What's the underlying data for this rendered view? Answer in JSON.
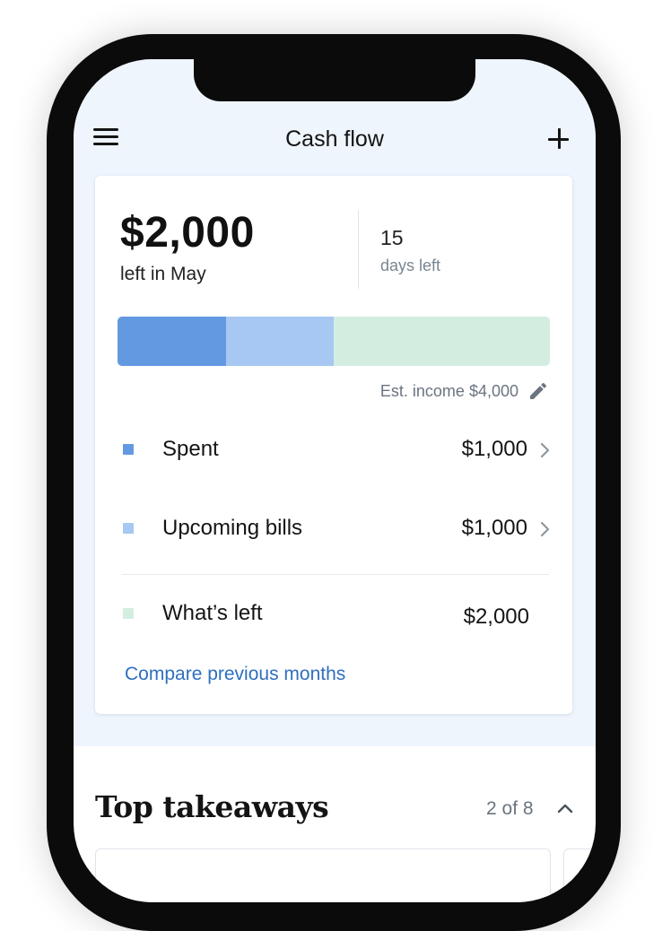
{
  "header": {
    "title": "Cash flow",
    "menu_icon": "hamburger-menu-icon",
    "add_icon": "plus-icon"
  },
  "summary": {
    "amount": "$2,000",
    "caption": "left in May",
    "days_count": "15",
    "days_label": "days left"
  },
  "progress_bar": {
    "total": 4000,
    "segments": [
      {
        "name": "Spent",
        "value": 1000,
        "color": "#6399e0"
      },
      {
        "name": "Upcoming bills",
        "value": 1000,
        "color": "#a6c8f2"
      },
      {
        "name": "What’s left",
        "value": 2000,
        "color": "#d3ede1"
      }
    ]
  },
  "income": {
    "label": "Est. income $4,000",
    "edit_icon": "pencil-icon"
  },
  "legend": [
    {
      "label": "Spent",
      "value": "$1,000",
      "color": "#6399e0",
      "chevron": true
    },
    {
      "label": "Upcoming bills",
      "value": "$1,000",
      "color": "#a6c8f2",
      "chevron": true
    },
    {
      "label": "What’s left",
      "value": "$2,000",
      "color": "#d3ede1",
      "chevron": false
    }
  ],
  "compare_link": "Compare previous months",
  "takeaways": {
    "title": "Top takeaways",
    "count": "2 of 8",
    "toggle_icon": "chevron-up-icon"
  },
  "colors": {
    "screen_bg": "#eef5fd",
    "link": "#2f6fbf"
  }
}
